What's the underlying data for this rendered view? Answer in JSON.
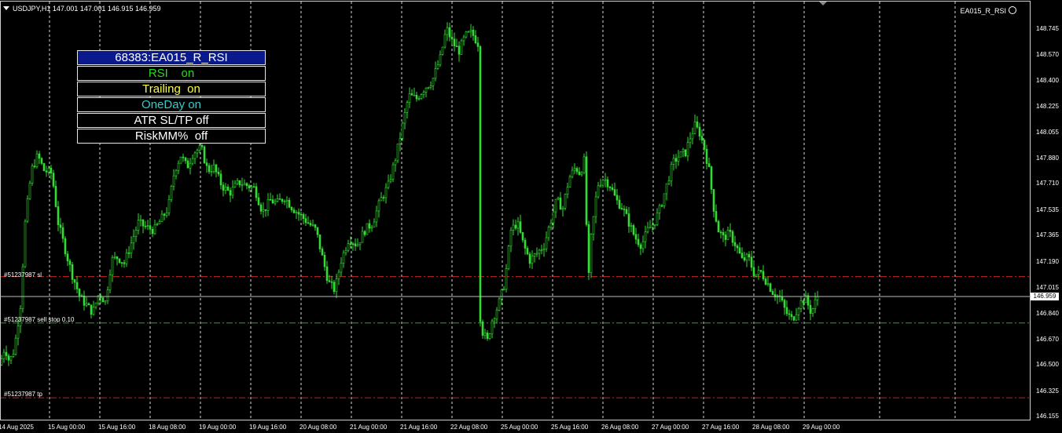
{
  "header": {
    "symbol_info": "USDJPY,H1  147.001 147.001 146.915 146.959"
  },
  "ea_label": "EA015_R_RSI",
  "panel": {
    "buttons": [
      {
        "label": "68383:EA015_R_RSI",
        "color": "#ffffff"
      },
      {
        "label": "RSI    on",
        "color": "#22dd22"
      },
      {
        "label": "Trailing  on",
        "color": "#ffff44"
      },
      {
        "label": "OneDay on",
        "color": "#33cccc"
      },
      {
        "label": "ATR SL/TP off",
        "color": "#ffffff"
      },
      {
        "label": "RiskMM%  off",
        "color": "#ffffff"
      }
    ]
  },
  "levels": {
    "sl": {
      "label": "#51237987 sl",
      "price": 147.09,
      "color": "#cc2222"
    },
    "entry": {
      "label": "#51237987 sell stop 0.10",
      "price": 146.78,
      "color": "#22aa22"
    },
    "tp": {
      "label": "#51237987 tp",
      "price": 146.28,
      "color": "#cc2222"
    }
  },
  "current_price": "146.959",
  "chart_data": {
    "type": "candlestick",
    "symbol": "USDJPY",
    "timeframe": "H1",
    "ylim": [
      146.13,
      148.87
    ],
    "y_ticks": [
      "148.745",
      "148.570",
      "148.400",
      "148.225",
      "148.055",
      "147.880",
      "147.710",
      "147.535",
      "147.365",
      "147.190",
      "147.015",
      "146.840",
      "146.670",
      "146.500",
      "146.325",
      "146.155"
    ],
    "x_ticks": [
      "14 Aug 2025",
      "15 Aug 00:00",
      "15 Aug 16:00",
      "18 Aug 08:00",
      "19 Aug 00:00",
      "19 Aug 16:00",
      "20 Aug 08:00",
      "21 Aug 00:00",
      "21 Aug 16:00",
      "22 Aug 08:00",
      "25 Aug 00:00",
      "25 Aug 16:00",
      "26 Aug 08:00",
      "27 Aug 00:00",
      "27 Aug 16:00",
      "28 Aug 08:00",
      "29 Aug 00:00"
    ],
    "close_path": [
      [
        0,
        146.5
      ],
      [
        6,
        146.62
      ],
      [
        12,
        146.52
      ],
      [
        18,
        146.6
      ],
      [
        26,
        146.9
      ],
      [
        32,
        147.45
      ],
      [
        40,
        147.8
      ],
      [
        48,
        147.9
      ],
      [
        56,
        147.8
      ],
      [
        66,
        147.78
      ],
      [
        74,
        147.45
      ],
      [
        84,
        147.25
      ],
      [
        92,
        147.1
      ],
      [
        102,
        146.95
      ],
      [
        110,
        146.9
      ],
      [
        118,
        146.85
      ],
      [
        126,
        146.98
      ],
      [
        134,
        146.92
      ],
      [
        142,
        147.2
      ],
      [
        150,
        147.22
      ],
      [
        158,
        147.18
      ],
      [
        166,
        147.3
      ],
      [
        176,
        147.45
      ],
      [
        186,
        147.42
      ],
      [
        196,
        147.4
      ],
      [
        206,
        147.48
      ],
      [
        214,
        147.55
      ],
      [
        222,
        147.8
      ],
      [
        230,
        147.9
      ],
      [
        238,
        147.82
      ],
      [
        246,
        147.92
      ],
      [
        256,
        147.95
      ],
      [
        264,
        147.8
      ],
      [
        272,
        147.82
      ],
      [
        282,
        147.7
      ],
      [
        292,
        147.65
      ],
      [
        304,
        147.72
      ],
      [
        314,
        147.7
      ],
      [
        324,
        147.68
      ],
      [
        334,
        147.52
      ],
      [
        344,
        147.6
      ],
      [
        352,
        147.58
      ],
      [
        362,
        147.62
      ],
      [
        372,
        147.55
      ],
      [
        382,
        147.5
      ],
      [
        392,
        147.45
      ],
      [
        402,
        147.4
      ],
      [
        410,
        147.22
      ],
      [
        418,
        147.05
      ],
      [
        426,
        147.0
      ],
      [
        434,
        147.2
      ],
      [
        444,
        147.35
      ],
      [
        454,
        147.3
      ],
      [
        464,
        147.4
      ],
      [
        474,
        147.45
      ],
      [
        484,
        147.6
      ],
      [
        494,
        147.7
      ],
      [
        504,
        147.9
      ],
      [
        512,
        148.1
      ],
      [
        520,
        148.3
      ],
      [
        530,
        148.28
      ],
      [
        540,
        148.35
      ],
      [
        550,
        148.4
      ],
      [
        560,
        148.55
      ],
      [
        568,
        148.75
      ],
      [
        576,
        148.65
      ],
      [
        584,
        148.6
      ],
      [
        592,
        148.7
      ],
      [
        600,
        148.72
      ],
      [
        608,
        148.65
      ],
      [
        610,
        146.85
      ],
      [
        614,
        146.72
      ],
      [
        620,
        146.66
      ],
      [
        626,
        146.8
      ],
      [
        634,
        146.9
      ],
      [
        642,
        147.05
      ],
      [
        650,
        147.4
      ],
      [
        658,
        147.45
      ],
      [
        666,
        147.3
      ],
      [
        674,
        147.2
      ],
      [
        684,
        147.25
      ],
      [
        692,
        147.3
      ],
      [
        700,
        147.45
      ],
      [
        708,
        147.6
      ],
      [
        716,
        147.55
      ],
      [
        724,
        147.75
      ],
      [
        732,
        147.82
      ],
      [
        738,
        147.78
      ],
      [
        744,
        147.88
      ],
      [
        748,
        147.0
      ],
      [
        752,
        147.35
      ],
      [
        760,
        147.7
      ],
      [
        768,
        147.75
      ],
      [
        776,
        147.7
      ],
      [
        784,
        147.6
      ],
      [
        792,
        147.55
      ],
      [
        800,
        147.45
      ],
      [
        808,
        147.35
      ],
      [
        816,
        147.3
      ],
      [
        824,
        147.4
      ],
      [
        832,
        147.45
      ],
      [
        840,
        147.55
      ],
      [
        848,
        147.7
      ],
      [
        856,
        147.85
      ],
      [
        864,
        147.9
      ],
      [
        872,
        147.92
      ],
      [
        878,
        148.02
      ],
      [
        884,
        148.1
      ],
      [
        890,
        148.05
      ],
      [
        896,
        147.95
      ],
      [
        902,
        147.8
      ],
      [
        908,
        147.55
      ],
      [
        914,
        147.4
      ],
      [
        920,
        147.35
      ],
      [
        928,
        147.38
      ],
      [
        936,
        147.3
      ],
      [
        944,
        147.2
      ],
      [
        952,
        147.22
      ],
      [
        960,
        147.1
      ],
      [
        968,
        147.12
      ],
      [
        976,
        147.05
      ],
      [
        984,
        146.98
      ],
      [
        992,
        146.95
      ],
      [
        1000,
        146.85
      ],
      [
        1008,
        146.8
      ],
      [
        1016,
        146.9
      ],
      [
        1024,
        146.95
      ],
      [
        1032,
        146.85
      ],
      [
        1040,
        146.96
      ]
    ]
  }
}
